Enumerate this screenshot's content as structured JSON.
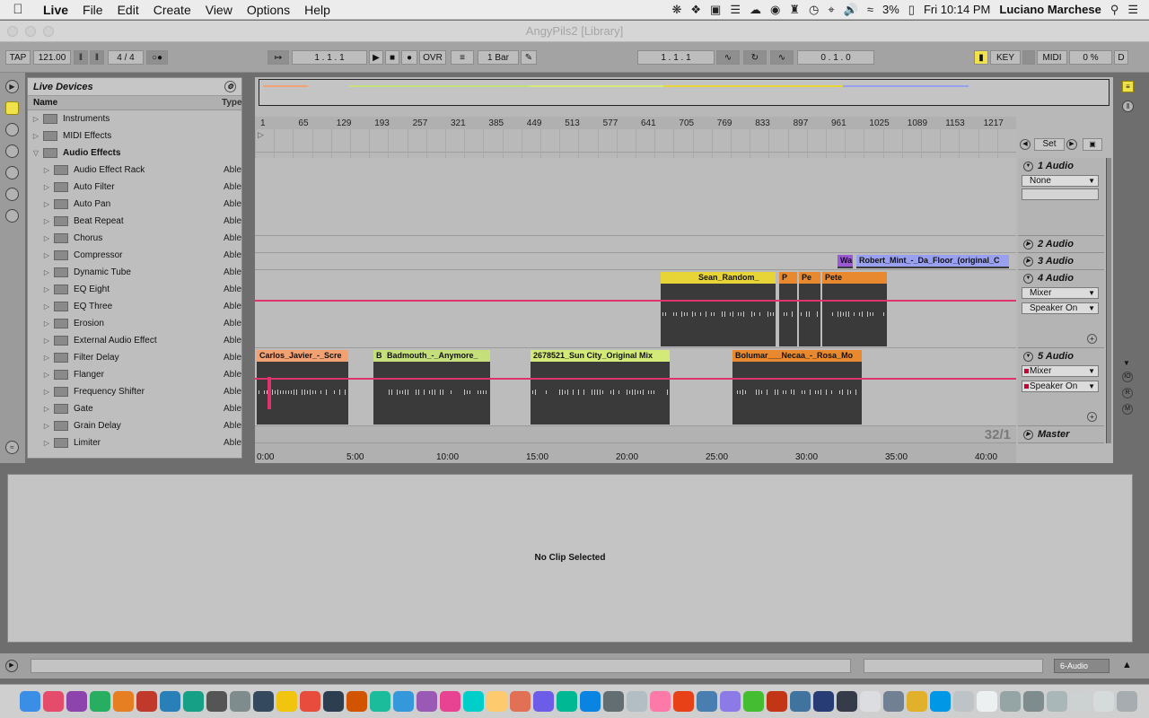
{
  "menubar": {
    "app": "Live",
    "menus": [
      "File",
      "Edit",
      "Create",
      "View",
      "Options",
      "Help"
    ],
    "battery": "3%",
    "clock": "Fri 10:14 PM",
    "user": "Luciano Marchese"
  },
  "window": {
    "title": "AngyPils2  [Library]"
  },
  "transport": {
    "tap": "TAP",
    "tempo": "121.00",
    "signature_num": "4",
    "signature_den": "4",
    "follow": "",
    "position": "1 .   1 .   1",
    "ovr": "OVR",
    "quantize": "1 Bar",
    "loop_start": "1 .   1 .   1",
    "loop_length": "0 .   1 .   0",
    "key": "KEY",
    "midi": "MIDI",
    "cpu": "0 %",
    "d": "D"
  },
  "browser": {
    "title": "Live Devices",
    "col_name": "Name",
    "col_type": "Type",
    "items": [
      {
        "label": "Instruments",
        "type": "",
        "level": 0,
        "open": false
      },
      {
        "label": "MIDI Effects",
        "type": "",
        "level": 0,
        "open": false
      },
      {
        "label": "Audio Effects",
        "type": "",
        "level": 0,
        "open": true
      },
      {
        "label": "Audio Effect Rack",
        "type": "Able",
        "level": 1
      },
      {
        "label": "Auto Filter",
        "type": "Able",
        "level": 1
      },
      {
        "label": "Auto Pan",
        "type": "Able",
        "level": 1
      },
      {
        "label": "Beat Repeat",
        "type": "Able",
        "level": 1
      },
      {
        "label": "Chorus",
        "type": "Able",
        "level": 1
      },
      {
        "label": "Compressor",
        "type": "Able",
        "level": 1
      },
      {
        "label": "Dynamic Tube",
        "type": "Able",
        "level": 1
      },
      {
        "label": "EQ Eight",
        "type": "Able",
        "level": 1
      },
      {
        "label": "EQ Three",
        "type": "Able",
        "level": 1
      },
      {
        "label": "Erosion",
        "type": "Able",
        "level": 1
      },
      {
        "label": "External Audio Effect",
        "type": "Able",
        "level": 1
      },
      {
        "label": "Filter Delay",
        "type": "Able",
        "level": 1
      },
      {
        "label": "Flanger",
        "type": "Able",
        "level": 1
      },
      {
        "label": "Frequency Shifter",
        "type": "Able",
        "level": 1
      },
      {
        "label": "Gate",
        "type": "Able",
        "level": 1
      },
      {
        "label": "Grain Delay",
        "type": "Able",
        "level": 1
      },
      {
        "label": "Limiter",
        "type": "Able",
        "level": 1
      }
    ]
  },
  "ruler": {
    "bars": [
      "1",
      "65",
      "129",
      "193",
      "257",
      "321",
      "385",
      "449",
      "513",
      "577",
      "641",
      "705",
      "769",
      "833",
      "897",
      "961",
      "1025",
      "1089",
      "1153",
      "1217"
    ],
    "times": [
      "0:00",
      "5:00",
      "10:00",
      "15:00",
      "20:00",
      "25:00",
      "30:00",
      "35:00",
      "40:00"
    ]
  },
  "set_button": "Set",
  "zoom_readout": "32/1",
  "tracks": [
    {
      "name": "1 Audio",
      "input": "None"
    },
    {
      "name": "2 Audio"
    },
    {
      "name": "3 Audio"
    },
    {
      "name": "4 Audio",
      "input": "Mixer",
      "output": "Speaker On"
    },
    {
      "name": "5 Audio",
      "input": "Mixer",
      "output": "Speaker On"
    },
    {
      "name": "Master"
    }
  ],
  "clips": {
    "track3": [
      {
        "name": "Wa",
        "color": "#9b59d6"
      },
      {
        "name": "Robert_Mint_-_Da_Floor_(original_C",
        "color": "#9aa0f0"
      }
    ],
    "track4": [
      {
        "name": "Sean_Random_",
        "color": "#e7d538"
      },
      {
        "name": "P",
        "color": "#e8892f"
      },
      {
        "name": "Pe",
        "color": "#e8892f"
      },
      {
        "name": "Pete",
        "color": "#e8892f"
      }
    ],
    "track5": [
      {
        "name": "Carlos_Javier_-_Scre",
        "color": "#f2a172"
      },
      {
        "name": "B",
        "color": "#c5e07a"
      },
      {
        "name": "Badmouth_-_Anymore_",
        "color": "#c5e07a"
      },
      {
        "name": "2678521_Sun City_Original Mix",
        "color": "#d4ea78"
      },
      {
        "name": "Bolumar___Necaa_-_Rosa_Mo",
        "color": "#e8892f"
      }
    ]
  },
  "detail": {
    "message": "No Clip Selected"
  },
  "statusbar": {
    "track": "6-Audio"
  },
  "colors": {
    "envelope": "#e0336b",
    "accent": "#f0e24a"
  }
}
